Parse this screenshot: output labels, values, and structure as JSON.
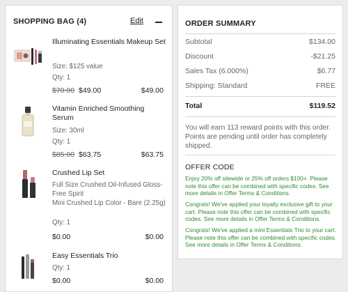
{
  "bag": {
    "title": "SHOPPING BAG (4)",
    "edit_label": "Edit",
    "items": [
      {
        "name": "Illuminating Essentials Makeup Set",
        "details": [
          "Size: $125 value",
          "Qty: 1"
        ],
        "old_price": "$70.00",
        "price": "$49.00",
        "line_total": "$49.00",
        "image": "makeup-set-product-image"
      },
      {
        "name": "Vitamin Enriched Smoothing Serum",
        "details": [
          "Size: 30ml",
          "Qty: 1"
        ],
        "old_price": "$85.00",
        "price": "$63.75",
        "line_total": "$63.75",
        "image": "serum-bottle-product-image"
      },
      {
        "name": "Crushed Lip Set",
        "details": [
          "Full Size Crushed Oil-Infused Gloss- Free Spirit",
          "Mini Crushed Lip Color - Bare (2.25g)",
          "Qty: 1"
        ],
        "old_price": "",
        "price": "$0.00",
        "line_total": "$0.00",
        "image": "lip-set-product-image"
      },
      {
        "name": "Easy Essentials Trio",
        "details": [
          "Qty: 1"
        ],
        "old_price": "",
        "price": "$0.00",
        "line_total": "$0.00",
        "image": "essentials-trio-product-image"
      }
    ]
  },
  "summary": {
    "title": "ORDER SUMMARY",
    "rows": [
      {
        "label": "Subtotal",
        "value": "$134.00"
      },
      {
        "label": "Discount",
        "value": "-$21.25"
      },
      {
        "label": "Sales Tax (6.000%)",
        "value": "$6.77"
      },
      {
        "label": "Shipping: Standard",
        "value": "FREE"
      }
    ],
    "total_label": "Total",
    "total_value": "$119.52",
    "reward_text": "You will earn 113 reward points with this order. Points are pending until order has completely shipped.",
    "offer_title": "OFFER CODE",
    "offers": [
      "Enjoy 20% off sitewide or 25% off orders $100+. Please note this offer can be combined with specific codes. See more details in Offer Terms & Conditions.",
      "Congrats! We've applied your loyalty exclusive gift to your cart. Please note this offer can be combined with specific codes. See more details in Offer Terms & Conditions.",
      "Congrats! We've applied a mini Essentials Trio to your cart. Please note this offer can be combined with specific codes. See more details in Offer Terms & Conditions."
    ]
  },
  "colors": {
    "offer_green": "#2e8b2e",
    "muted_text": "#666666",
    "panel_border": "#d9d9d9"
  }
}
